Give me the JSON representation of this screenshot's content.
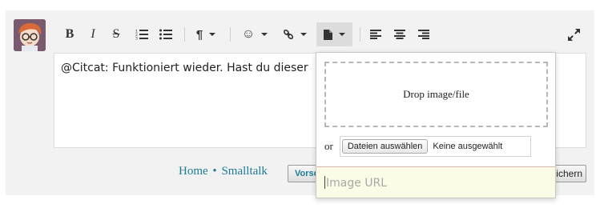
{
  "toolbar": {
    "bold": "B",
    "italic": "I",
    "strike": "S",
    "paragraph": "¶",
    "emoji": "☺",
    "link": "🔗"
  },
  "editor": {
    "text": "@Citcat: Funktioniert wieder. Hast du dieser"
  },
  "footer": {
    "home": "Home",
    "separator": "•",
    "smalltalk": "Smalltalk",
    "preview_label": "Vorschau",
    "save_label": "Speichern"
  },
  "upload_popup": {
    "drop_label": "Drop image/file",
    "or_label": "or",
    "choose_files": "Dateien auswählen",
    "no_file": "Keine ausgewählt",
    "url_placeholder": "Image URL"
  }
}
